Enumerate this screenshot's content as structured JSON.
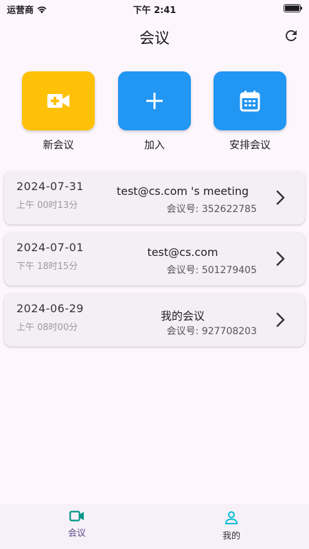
{
  "status_bar": {
    "carrier": "运营商",
    "time": "下午 2:41",
    "battery_level": 1.0
  },
  "header": {
    "title": "会议",
    "refresh_icon": "refresh-icon"
  },
  "actions": [
    {
      "label": "新会议",
      "icon": "video-add-icon",
      "color": "#ffc107"
    },
    {
      "label": "加入",
      "icon": "plus-icon",
      "color": "#2196f3"
    },
    {
      "label": "安排会议",
      "icon": "calendar-icon",
      "color": "#2196f3"
    }
  ],
  "meetings": [
    {
      "date": "2024-07-31",
      "time": "上午 00时13分",
      "topic": "test@cs.com 's meeting",
      "number_label": "会议号: 352622785"
    },
    {
      "date": "2024-07-01",
      "time": "下午 18时15分",
      "topic": "test@cs.com",
      "number_label": "会议号: 501279405"
    },
    {
      "date": "2024-06-29",
      "time": "上午 08时00分",
      "topic": "我的会议",
      "number_label": "会议号: 927708203"
    }
  ],
  "bottom_nav": {
    "items": [
      {
        "label": "会议",
        "icon": "video-icon",
        "active": true
      },
      {
        "label": "我的",
        "icon": "person-icon",
        "active": false
      }
    ],
    "active_color": "#009688",
    "inactive_color": "#00bcd4"
  }
}
